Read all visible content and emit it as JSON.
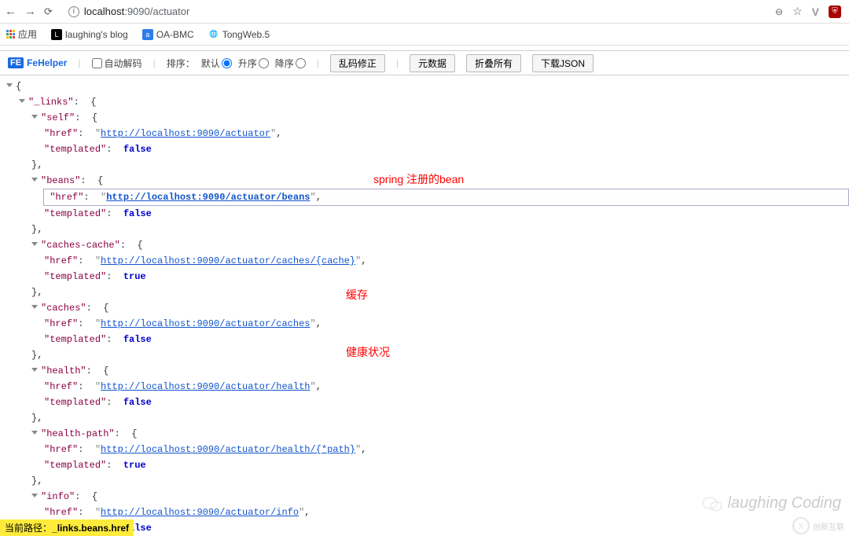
{
  "browser": {
    "address_host": "localhost",
    "address_port_path": ":9090/actuator"
  },
  "bookmarks": {
    "apps": "应用",
    "items": [
      {
        "label": "laughing's blog"
      },
      {
        "label": "OA-BMC"
      },
      {
        "label": "TongWeb.5"
      }
    ]
  },
  "fehelper": {
    "brand": "FeHelper",
    "auto_decode": "自动解码",
    "sort_label": "排序：",
    "sort_default": "默认",
    "sort_asc": "升序",
    "sort_desc": "降序",
    "btn_fix": "乱码修正",
    "btn_meta": "元数据",
    "btn_fold": "折叠所有",
    "btn_download": "下载JSON"
  },
  "json_keys": {
    "links": "_links",
    "self": "self",
    "href": "href",
    "templated": "templated",
    "beans": "beans",
    "caches_cache": "caches-cache",
    "caches": "caches",
    "health": "health",
    "health_path": "health-path",
    "info": "info"
  },
  "json_vals": {
    "self_href": "http://localhost:9090/actuator",
    "beans_href": "http://localhost:9090/actuator/beans",
    "caches_cache_href": "http://localhost:9090/actuator/caches/{cache}",
    "caches_href": "http://localhost:9090/actuator/caches",
    "health_href": "http://localhost:9090/actuator/health",
    "health_path_href": "http://localhost:9090/actuator/health/{*path}",
    "info_href": "http://localhost:9090/actuator/info",
    "false": "false",
    "true": "true"
  },
  "annotations": {
    "beans": "spring 注册的bean",
    "caches": "缓存",
    "health": "健康状况"
  },
  "footer": {
    "path_label": "当前路径：",
    "path_value": "_links.beans.href"
  },
  "watermark": "laughing Coding",
  "cx": "创新互联"
}
